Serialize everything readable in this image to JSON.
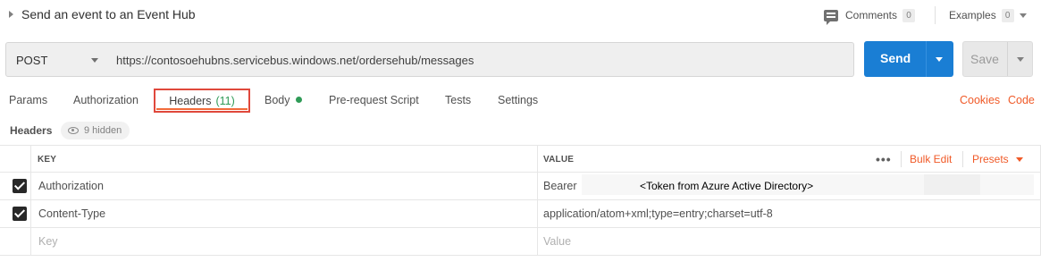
{
  "header": {
    "title": "Send an event to an Event Hub",
    "comments_label": "Comments",
    "comments_count": "0",
    "examples_label": "Examples",
    "examples_count": "0"
  },
  "request": {
    "method": "POST",
    "url": "https://contosoehubns.servicebus.windows.net/ordersehub/messages",
    "send_label": "Send",
    "save_label": "Save"
  },
  "tabs": {
    "params": "Params",
    "authorization": "Authorization",
    "headers": "Headers",
    "headers_count": "(11)",
    "body": "Body",
    "prerequest": "Pre-request Script",
    "tests": "Tests",
    "settings": "Settings",
    "cookies": "Cookies",
    "code": "Code"
  },
  "headers_section": {
    "label": "Headers",
    "hidden_text": "9 hidden"
  },
  "table": {
    "key_header": "KEY",
    "value_header": "VALUE",
    "more_icon_text": "•••",
    "bulk_edit": "Bulk Edit",
    "presets": "Presets",
    "rows": [
      {
        "key": "Authorization",
        "value": "Bearer",
        "token": "<Token from Azure Active Directory>",
        "checked": true
      },
      {
        "key": "Content-Type",
        "value": "application/atom+xml;type=entry;charset=utf-8",
        "checked": true
      }
    ],
    "new_row": {
      "key_placeholder": "Key",
      "value_placeholder": "Value"
    }
  },
  "colors": {
    "accent_orange": "#f05a28",
    "send_blue": "#1a7ed4",
    "highlight_red": "#e0483c",
    "green": "#2f9b57"
  }
}
